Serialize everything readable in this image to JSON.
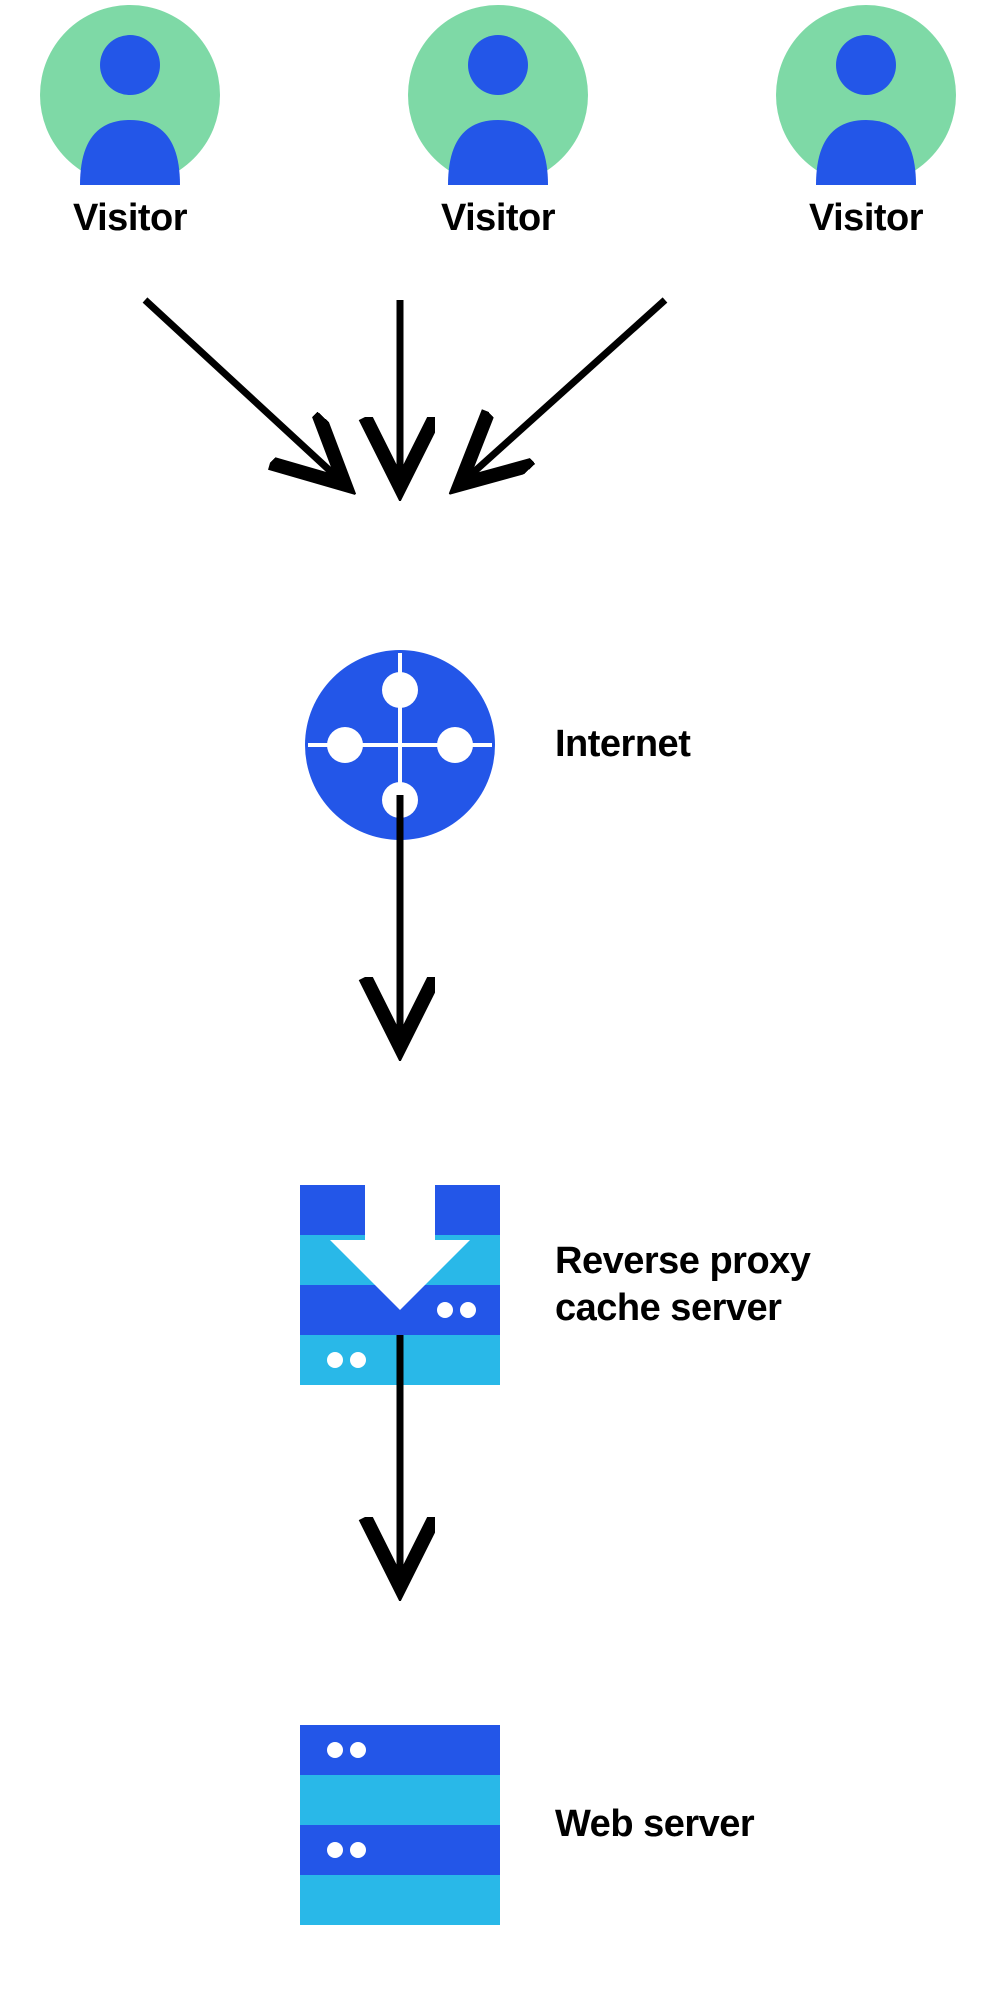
{
  "visitors": [
    {
      "label": "Visitor"
    },
    {
      "label": "Visitor"
    },
    {
      "label": "Visitor"
    }
  ],
  "internet_label": "Internet",
  "proxy_label": "Reverse proxy\ncache server",
  "webserver_label": "Web server",
  "colors": {
    "avatar_bg": "#7ED9A6",
    "avatar_fg": "#2356E8",
    "blue": "#2356E8",
    "lightblue": "#29B8E8",
    "black": "#000000"
  }
}
